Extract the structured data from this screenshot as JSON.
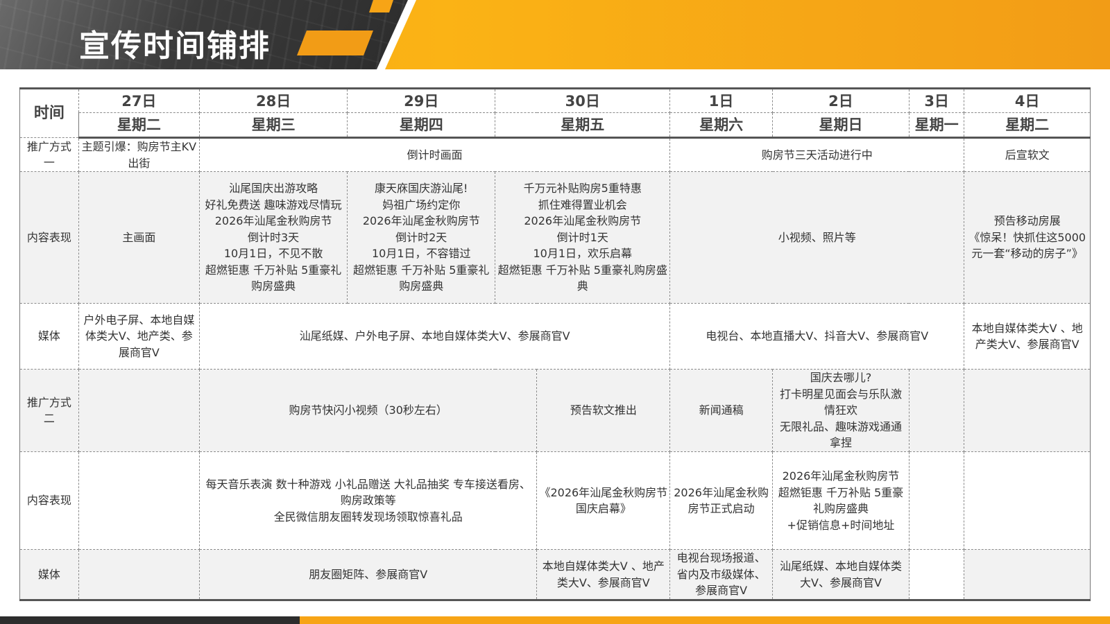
{
  "page": {
    "title": "宣传时间铺排"
  },
  "table": {
    "corner": "时间",
    "dates": [
      "27日",
      "28日",
      "29日",
      "30日",
      "1日",
      "2日",
      "3日",
      "4日"
    ],
    "weekdays": [
      "星期二",
      "星期三",
      "星期四",
      "星期五",
      "星期六",
      "星期日",
      "星期一",
      "星期二"
    ],
    "rows": {
      "promo1": {
        "label": "推广方式一",
        "d27": "主题引爆：购房节主KV出街",
        "d28_30": "倒计时画面",
        "d1_3": "购房节三天活动进行中",
        "d4": "后宣软文"
      },
      "content1": {
        "label": "内容表现",
        "d27": "主画面",
        "d28": "汕尾国庆出游攻略\n好礼免费送 趣味游戏尽情玩\n2026年汕尾金秋购房节\n倒计时3天\n10月1日，不见不散\n超燃钜惠 千万补贴 5重豪礼购房盛典",
        "d29": "康天庥国庆游汕尾!\n妈祖广场约定你\n2026年汕尾金秋购房节\n倒计时2天\n10月1日，不容错过\n超燃钜惠 千万补贴 5重豪礼购房盛典",
        "d30": "千万元补贴购房5重特惠\n抓住难得置业机会\n2026年汕尾金秋购房节\n倒计时1天\n10月1日，欢乐启幕\n超燃钜惠 千万补贴 5重豪礼购房盛典",
        "d1_3": "小视频、照片等",
        "d4": "预告移动房展\n《惊呆！快抓住这5000元一套“移动的房子”》"
      },
      "media1": {
        "label": "媒体",
        "d27": "户外电子屏、本地自媒体类大V、地产类、参展商官V",
        "d28_30": "汕尾纸媒、户外电子屏、本地自媒体类大V、参展商官V",
        "d1_3": "电视台、本地直播大V、抖音大V、参展商官V",
        "d4": "本地自媒体类大V 、地产类大V、参展商官V"
      },
      "promo2": {
        "label": "推广方式二",
        "d27": "",
        "d28_30a": "购房节快闪小视频（30秒左右）",
        "d30b": "预告软文推出",
        "d1": "新闻通稿",
        "d2": "国庆去哪儿?\n打卡明星见面会与乐队激情狂欢\n无限礼品、趣味游戏通通拿捏",
        "d3": "",
        "d4": ""
      },
      "content2": {
        "label": "内容表现",
        "d27": "",
        "d28_30a": "每天音乐表演 数十种游戏 小礼品赠送 大礼品抽奖 专车接送看房、购房政策等\n全民微信朋友圈转发现场领取惊喜礼品",
        "d30b": "《2026年汕尾金秋购房节国庆启幕》",
        "d1": "2026年汕尾金秋购房节正式启动",
        "d2": "2026年汕尾金秋购房节\n超燃钜惠 千万补贴 5重豪礼购房盛典\n+促销信息+时间地址",
        "d3": "",
        "d4": ""
      },
      "media2": {
        "label": "媒体",
        "d27": "",
        "d28_30a": "朋友圈矩阵、参展商官V",
        "d30b": "本地自媒体类大V 、地产类大V、参展商官V",
        "d1": "电视台现场报道、省内及市级媒体、参展商官V",
        "d2": "汕尾纸媒、本地自媒体类大V、参展商官V",
        "d3": "",
        "d4": ""
      }
    }
  },
  "colors": {
    "accent": "#f7a416",
    "dark": "#2d2d2d",
    "row_shade": "#f2f2f2"
  }
}
